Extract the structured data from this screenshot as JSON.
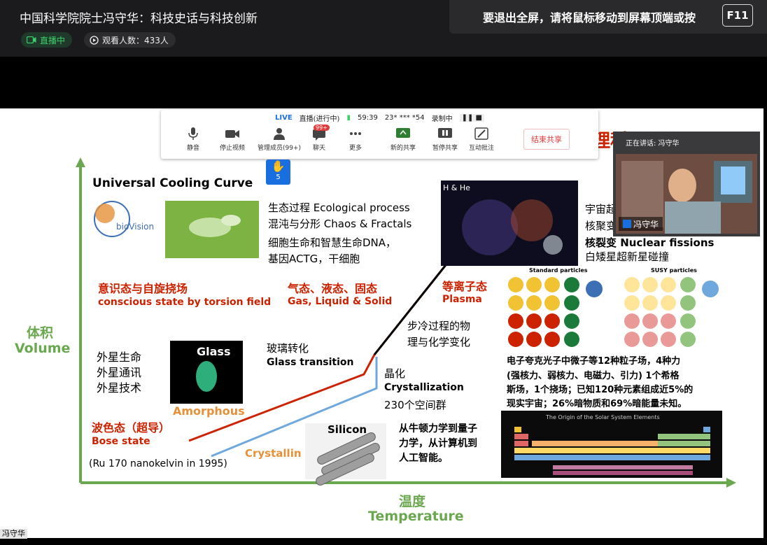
{
  "header": {
    "title": "中国科学院院士冯守华：科技史话与科技创新",
    "live_label": "直播中",
    "viewers_label": "观看人数：433人",
    "exit_hint": "要退出全屏，请将鼠标移动到屏幕顶端或按",
    "exit_key": "F11"
  },
  "meeting": {
    "live": "LIVE",
    "live_status": "直播(进行中)",
    "timer": "59:39",
    "meeting_id": "23* *** *54",
    "recording": "录制中",
    "mute": "静音",
    "stop_video": "停止视频",
    "members": "管理成员(99+)",
    "chat": "聊天",
    "chat_badge": "99+",
    "more": "更多",
    "new_share": "新的共享",
    "pause_share": "暂停共享",
    "annotate": "互动批注",
    "end_share": "结束共享",
    "raised_hands": "5"
  },
  "speaker": {
    "speaking_label": "正在讲话: 冯守华",
    "name": "冯守华"
  },
  "bottom_name": "冯守华",
  "slide": {
    "title": "Universal Cooling Curve",
    "logo_text": "bioVision",
    "eco1": "生态过程 Ecological process",
    "eco2": "混沌与分形 Chaos & Fractals",
    "eco3": "细胞生命和智慧生命DNA，",
    "eco4": "基因ACTG，干细胞",
    "consc_cn": "意识态与自旋挠场",
    "consc_en": "conscious state by torsion field",
    "gas_cn": "气态、液态、固态",
    "gas_en": "Gas, Liquid & Solid",
    "plasma_cn": "等离子态",
    "plasma_en": "Plasma",
    "hhe": "H & He",
    "universe1": "宇宙起",
    "universe2": "核聚变",
    "universe3": "核裂变 Nuclear fissions",
    "universe4": "白矮星超新星碰撞",
    "std_particles": "Standard particles",
    "susy_particles": "SUSY particles",
    "process1": "步冷过程的物",
    "process2": "理与化学变化",
    "forces1": "电子夸克光子中微子等12种粒子场，4种力",
    "forces2": "(强核力、弱核力、电磁力、引力) 1个希格",
    "forces3": "斯场，1个挠场；已知120种元素组成近5%的",
    "forces4": "现实宇宙；26%暗物质和69%暗能量未知。",
    "volume_cn": "体积",
    "volume_en": "Volume",
    "alien1": "外星生命",
    "alien2": "外星通讯",
    "alien3": "外星技术",
    "glass": "Glass",
    "amorphous": "Amorphous",
    "glass_cn": "玻璃转化",
    "glass_en": "Glass transition",
    "cryst_cn": "晶化",
    "cryst_en": "Crystallization",
    "cryst_groups": "230个空间群",
    "bose_cn": "波色态（超导）",
    "bose_en": "Bose state",
    "ru": "(Ru 170 nanokelvin in 1995)",
    "crystallin": "Crystallin",
    "silicon": "Silicon",
    "newton1": "从牛顿力学到量子",
    "newton2": "力学，从计算机到",
    "newton3": "人工智能。",
    "periodic_title": "The Origin of the Solar System Elements",
    "temp_cn": "温度",
    "temp_en": "Temperature",
    "red_partial": "理科"
  },
  "colors": {
    "axis_green": "#6aa84f",
    "red": "#cc2200",
    "blue": "#6fa8dc",
    "orange": "#e69138"
  }
}
